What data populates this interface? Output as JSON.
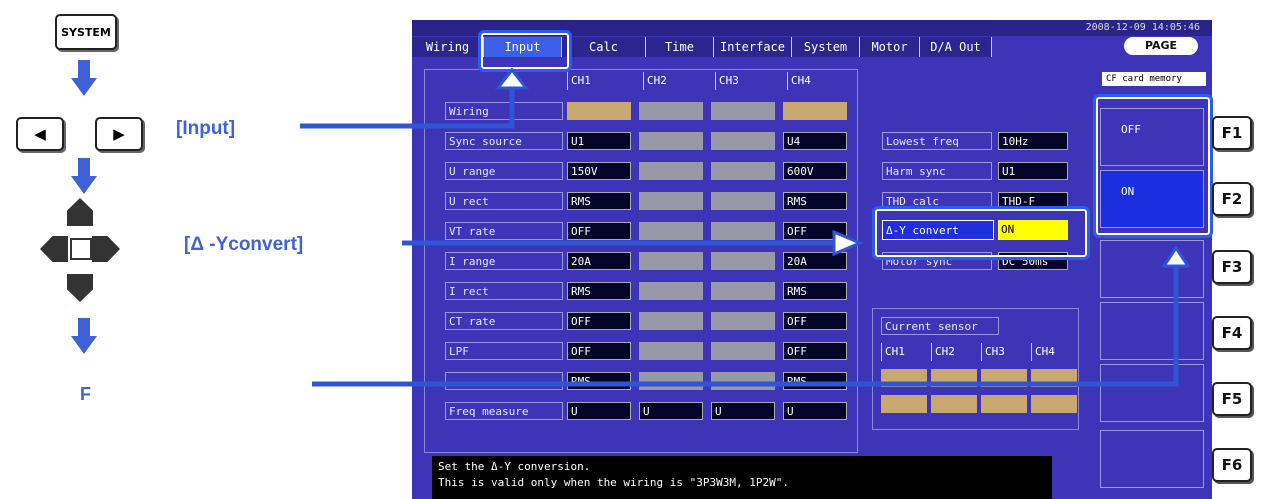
{
  "steps": {
    "system_key": "SYSTEM",
    "left_arrow": "◀",
    "right_arrow": "▶",
    "input_callout": "[Input]",
    "delta_callout": "[Δ -Yconvert]",
    "f_callout": "F"
  },
  "screen": {
    "clock": "2008-12-09 14:05:46",
    "page_button": "PAGE",
    "tabs": [
      {
        "label": "Wiring"
      },
      {
        "label": "Input"
      },
      {
        "label": "Calc"
      },
      {
        "label": "Time"
      },
      {
        "label": "Interface"
      },
      {
        "label": "System"
      },
      {
        "label": "Motor"
      },
      {
        "label": "D/A Out"
      }
    ],
    "active_tab": "Input",
    "channels": [
      "CH1",
      "CH2",
      "CH3",
      "CH4"
    ],
    "rows": [
      {
        "label": "Wiring",
        "ch1": "",
        "ch4": ""
      },
      {
        "label": "Sync source",
        "ch1": "U1",
        "ch4": "U4"
      },
      {
        "label": "U range",
        "ch1": "150V",
        "ch4": "600V"
      },
      {
        "label": "U rect",
        "ch1": "RMS",
        "ch4": "RMS"
      },
      {
        "label": "VT rate",
        "ch1": "OFF",
        "ch4": "OFF"
      },
      {
        "label": "I range",
        "ch1": "20A",
        "ch4": "20A"
      },
      {
        "label": "I rect",
        "ch1": "RMS",
        "ch4": "RMS"
      },
      {
        "label": "CT rate",
        "ch1": "OFF",
        "ch4": "OFF"
      },
      {
        "label": "LPF",
        "ch1": "OFF",
        "ch4": "OFF"
      },
      {
        "label": "",
        "ch1": "RMS",
        "ch4": "RMS"
      },
      {
        "label": "Freq measure",
        "ch1": "U",
        "ch2": "U",
        "ch3": "U",
        "ch4": "U"
      }
    ],
    "right_settings": [
      {
        "label": "Lowest freq",
        "value": "10Hz"
      },
      {
        "label": "Harm sync",
        "value": "U1"
      },
      {
        "label": "THD calc",
        "value": "THD-F"
      },
      {
        "label": "Δ-Y convert",
        "value": "ON"
      },
      {
        "label": "Motor sync",
        "value": "DC 50ms"
      }
    ],
    "current_sensor": {
      "title": "Current sensor",
      "channels": [
        "CH1",
        "CH2",
        "CH3",
        "CH4"
      ]
    },
    "cf_label": "CF card memory",
    "fbuttons": [
      {
        "label": "OFF"
      },
      {
        "label": "ON"
      }
    ],
    "message_line1": "Set the Δ-Y conversion.",
    "message_line2": "This is valid only when the wiring is \"3P3W3M, 1P2W\"."
  },
  "fkeys": [
    "F1",
    "F2",
    "F3",
    "F4",
    "F5",
    "F6"
  ],
  "colors": {
    "accent": "#2f55d4",
    "screen_bg": "#3d34b8",
    "highlight_value": "#ffff00"
  }
}
